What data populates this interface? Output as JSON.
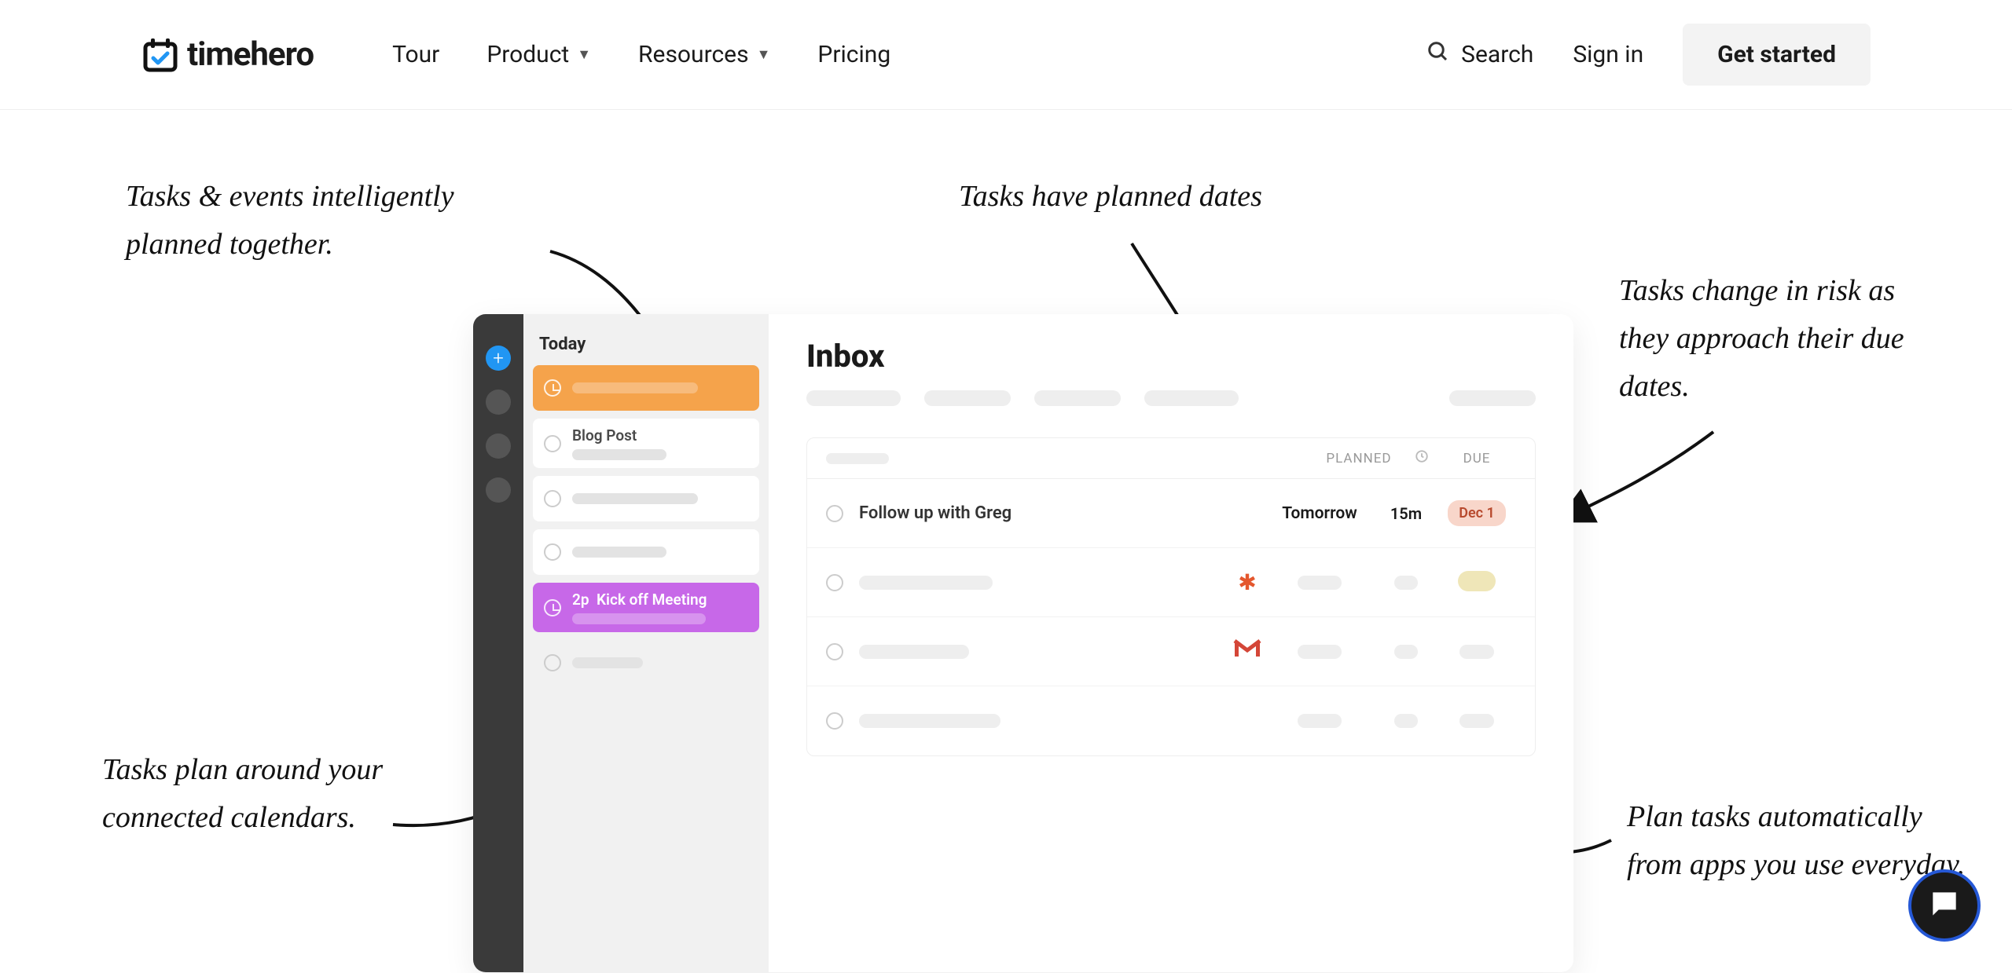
{
  "header": {
    "logo_text": "timehero",
    "nav": {
      "tour": "Tour",
      "product": "Product",
      "resources": "Resources",
      "pricing": "Pricing"
    },
    "search": "Search",
    "signin": "Sign in",
    "get_started": "Get started"
  },
  "annotations": {
    "a1": "Tasks & events intelligently planned together.",
    "a2": "Tasks have planned dates",
    "a3": "Tasks change in risk as they approach their due dates.",
    "a4": "Tasks plan around your connected calendars.",
    "a5": "Plan tasks automatically from apps you use everyday."
  },
  "app": {
    "sidebar_title": "Today",
    "cards": {
      "blog_post": "Blog Post",
      "kickoff_time": "2p",
      "kickoff_label": "Kick off Meeting"
    },
    "main": {
      "title": "Inbox",
      "table_head": {
        "planned": "PLANNED",
        "due": "DUE"
      },
      "row1": {
        "task": "Follow up with Greg",
        "planned": "Tomorrow",
        "duration": "15m",
        "due": "Dec 1"
      }
    }
  }
}
